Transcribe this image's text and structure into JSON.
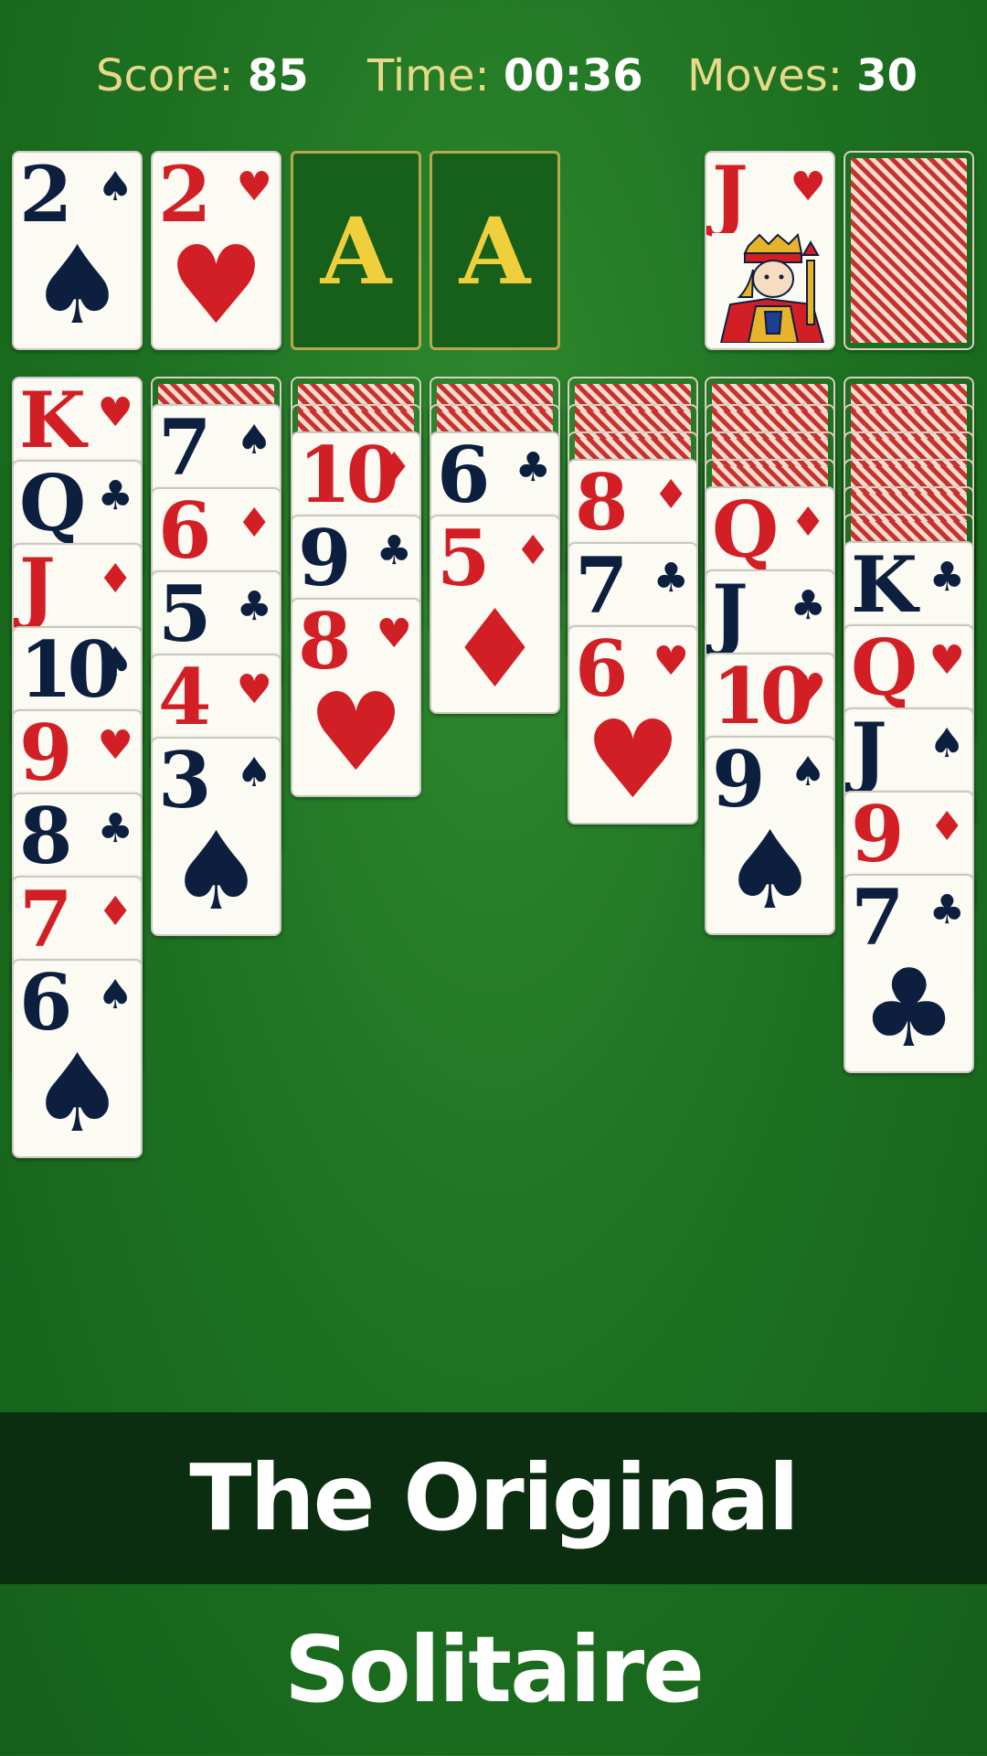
{
  "hud": {
    "score_label": "Score:",
    "score_value": "85",
    "time_label": "Time:",
    "time_value": "00:36",
    "moves_label": "Moves:",
    "moves_value": "30"
  },
  "top_row": {
    "foundations": [
      {
        "rank": "2",
        "suit": "♠",
        "color": "black"
      },
      {
        "rank": "2",
        "suit": "♥",
        "color": "red"
      },
      {
        "label": "A"
      },
      {
        "label": "A"
      }
    ],
    "waste": {
      "rank": "J",
      "suit": "♥",
      "color": "red"
    },
    "stock": {
      "face_down": true
    }
  },
  "tableau": [
    {
      "face_down": 0,
      "cards": [
        {
          "rank": "K",
          "suit": "♥",
          "color": "red"
        },
        {
          "rank": "Q",
          "suit": "♣",
          "color": "black"
        },
        {
          "rank": "J",
          "suit": "♦",
          "color": "red"
        },
        {
          "rank": "10",
          "suit": "♠",
          "color": "black"
        },
        {
          "rank": "9",
          "suit": "♥",
          "color": "red"
        },
        {
          "rank": "8",
          "suit": "♣",
          "color": "black"
        },
        {
          "rank": "7",
          "suit": "♦",
          "color": "red"
        },
        {
          "rank": "6",
          "suit": "♠",
          "color": "black"
        }
      ]
    },
    {
      "face_down": 1,
      "cards": [
        {
          "rank": "7",
          "suit": "♠",
          "color": "black"
        },
        {
          "rank": "6",
          "suit": "♦",
          "color": "red"
        },
        {
          "rank": "5",
          "suit": "♣",
          "color": "black"
        },
        {
          "rank": "4",
          "suit": "♥",
          "color": "red"
        },
        {
          "rank": "3",
          "suit": "♠",
          "color": "black"
        }
      ]
    },
    {
      "face_down": 2,
      "cards": [
        {
          "rank": "10",
          "suit": "♦",
          "color": "red"
        },
        {
          "rank": "9",
          "suit": "♣",
          "color": "black"
        },
        {
          "rank": "8",
          "suit": "♥",
          "color": "red"
        }
      ]
    },
    {
      "face_down": 2,
      "cards": [
        {
          "rank": "6",
          "suit": "♣",
          "color": "black"
        },
        {
          "rank": "5",
          "suit": "♦",
          "color": "red"
        }
      ]
    },
    {
      "face_down": 3,
      "cards": [
        {
          "rank": "8",
          "suit": "♦",
          "color": "red"
        },
        {
          "rank": "7",
          "suit": "♣",
          "color": "black"
        },
        {
          "rank": "6",
          "suit": "♥",
          "color": "red"
        }
      ]
    },
    {
      "face_down": 4,
      "cards": [
        {
          "rank": "Q",
          "suit": "♦",
          "color": "red"
        },
        {
          "rank": "J",
          "suit": "♣",
          "color": "black"
        },
        {
          "rank": "10",
          "suit": "♥",
          "color": "red"
        },
        {
          "rank": "9",
          "suit": "♠",
          "color": "black"
        }
      ]
    },
    {
      "face_down": 6,
      "cards": [
        {
          "rank": "K",
          "suit": "♣",
          "color": "black"
        },
        {
          "rank": "Q",
          "suit": "♥",
          "color": "red"
        },
        {
          "rank": "J",
          "suit": "♠",
          "color": "black"
        },
        {
          "rank": "9",
          "suit": "♦",
          "color": "red"
        },
        {
          "rank": "7",
          "suit": "♣",
          "color": "black"
        }
      ]
    }
  ],
  "banner": {
    "text": "The Original Solitaire"
  },
  "colors": {
    "felt": "#1f7322",
    "hud_label": "#e8d98a",
    "red_suit": "#d21f26",
    "black_suit": "#0d1f3f",
    "foundation_letter": "#f0cf3c",
    "banner_bg": "#0a2e0f"
  }
}
